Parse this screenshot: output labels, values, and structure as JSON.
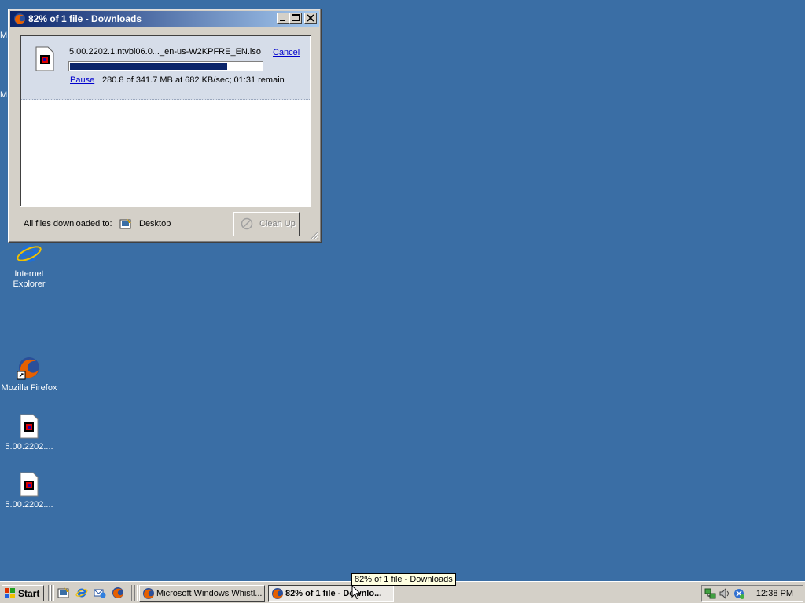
{
  "window": {
    "title": "82% of 1 file - Downloads",
    "download": {
      "filename": "5.00.2202.1.ntvbl06.0..._en-us-W2KPFRE_EN.iso",
      "cancel_label": "Cancel",
      "pause_label": "Pause",
      "status": "280.8 of 341.7 MB at 682 KB/sec; 01:31 remain",
      "progress_percent": 82
    },
    "footer": {
      "label": "All files downloaded to:",
      "folder": "Desktop",
      "cleanup_label": "Clean Up"
    }
  },
  "desktop": {
    "icons": [
      {
        "label": "Internet Explorer",
        "icon": "internet-explorer-icon"
      },
      {
        "label": "Mozilla Firefox",
        "icon": "firefox-icon"
      },
      {
        "label": "5.00.2202....",
        "icon": "iso-file-icon"
      },
      {
        "label": "5.00.2202....",
        "icon": "iso-file-icon"
      }
    ],
    "edge_letters": [
      "M",
      "M"
    ]
  },
  "taskbar": {
    "start_label": "Start",
    "tasks": [
      {
        "label": "Microsoft Windows Whistl..."
      },
      {
        "label": "82% of 1 file - Downlo..."
      }
    ],
    "clock": "12:38 PM",
    "tooltip": "82% of 1 file - Downloads"
  },
  "colors": {
    "desktop": "#3a6ea5",
    "titlebar_start": "#0a246a",
    "titlebar_end": "#a6caf0",
    "progress_fill": "#0a246a"
  }
}
